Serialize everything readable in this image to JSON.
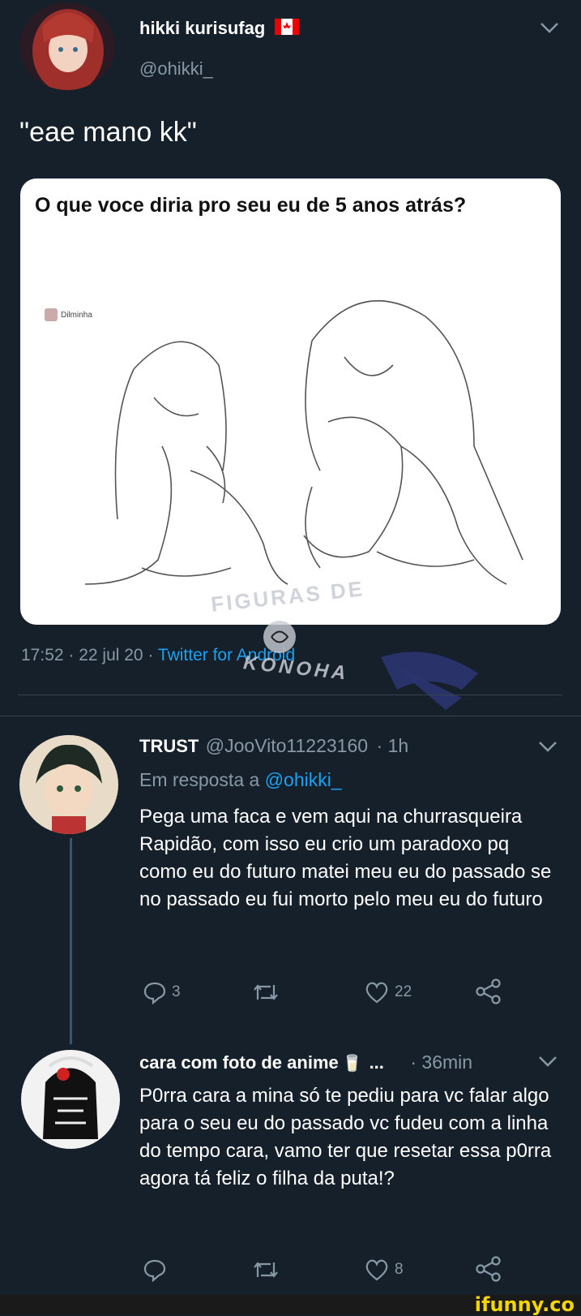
{
  "tweet": {
    "display_name": "hikki kurisufag",
    "flag_icon": "canada-flag-icon",
    "handle": "@ohikki_",
    "text": "\"eae mano kk\"",
    "image": {
      "question": "O que voce diria pro seu eu de 5 anos atrás?",
      "credit": "Dilminha"
    },
    "timestamp": "17:52 · 22 jul 20 · ",
    "source": "Twitter for Android",
    "watermark_top": "FIGURAS DE",
    "watermark_bottom": "KONOHA"
  },
  "reply1": {
    "display_name": "TRUST",
    "handle": "@JooVito11223160",
    "time": "· 1h",
    "reply_prefix": "Em resposta a ",
    "reply_to": "@ohikki_",
    "text": "Pega uma faca e vem aqui na churrasqueira Rapidão, com isso eu crio um paradoxo pq como eu do futuro matei meu eu do passado se no passado eu fui morto pelo meu eu do futuro",
    "actions": {
      "replies": "3",
      "retweets": "",
      "likes": "22"
    }
  },
  "reply2": {
    "display_name": "cara com foto de anime",
    "emoji": "🥛",
    "ellipsis": "...",
    "time": "· 36min",
    "text": "P0rra cara a mina só te pediu para vc falar algo para o seu eu do passado vc fudeu com a linha do tempo cara, vamo ter que resetar essa p0rra agora tá feliz o filha da puta!?",
    "actions": {
      "replies": "",
      "retweets": "",
      "likes": "8"
    }
  },
  "footer": {
    "brand": "ifunny.co"
  },
  "colors": {
    "background": "#15202b",
    "muted": "#8899a6",
    "accent": "#1da1f2",
    "divider": "#38444d"
  }
}
